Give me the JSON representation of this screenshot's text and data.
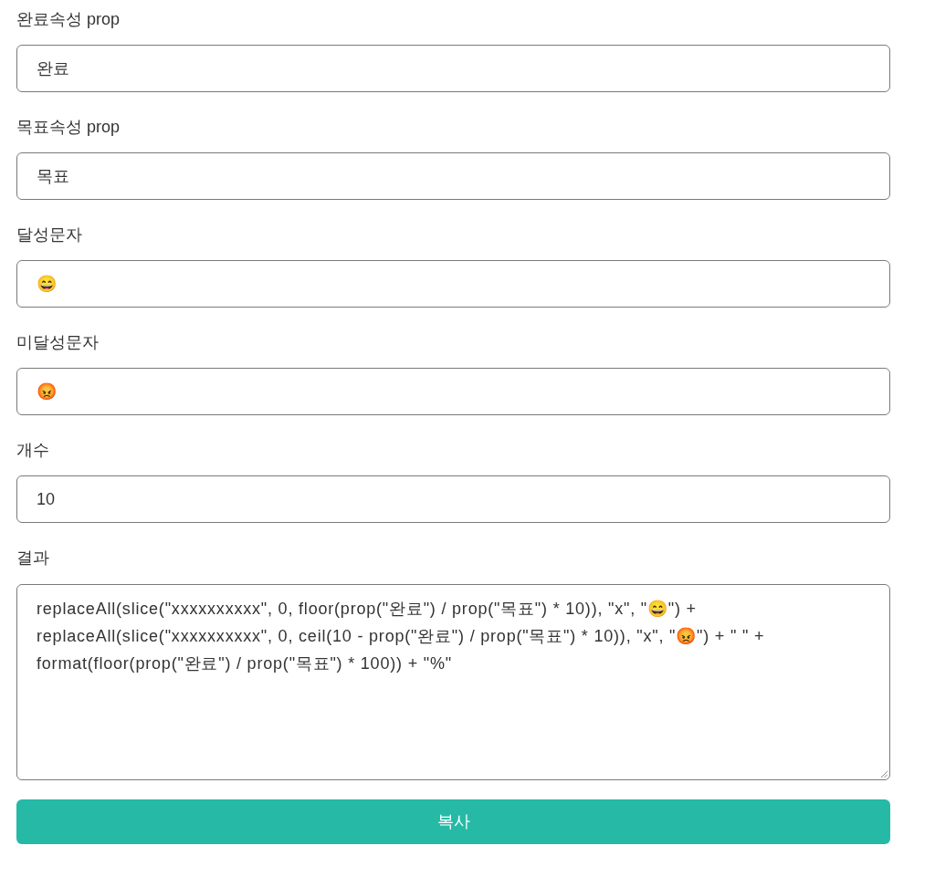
{
  "fields": [
    {
      "kind": "input",
      "label": "완료속성 prop",
      "value": "완료"
    },
    {
      "kind": "input",
      "label": "목표속성 prop",
      "value": "목표"
    },
    {
      "kind": "input",
      "label": "달성문자",
      "value": "😄"
    },
    {
      "kind": "input",
      "label": "미달성문자",
      "value": "😡"
    },
    {
      "kind": "input",
      "label": "개수",
      "value": "10"
    },
    {
      "kind": "textarea",
      "label": "결과",
      "value": "replaceAll(slice(\"xxxxxxxxxx\", 0, floor(prop(\"완료\") / prop(\"목표\") * 10)), \"x\", \"😄\") + replaceAll(slice(\"xxxxxxxxxx\", 0, ceil(10 - prop(\"완료\") / prop(\"목표\") * 10)), \"x\", \"😡\") + \" \" + format(floor(prop(\"완료\") / prop(\"목표\") * 100)) + \"%\""
    }
  ],
  "copy_button": {
    "label": "복사"
  }
}
